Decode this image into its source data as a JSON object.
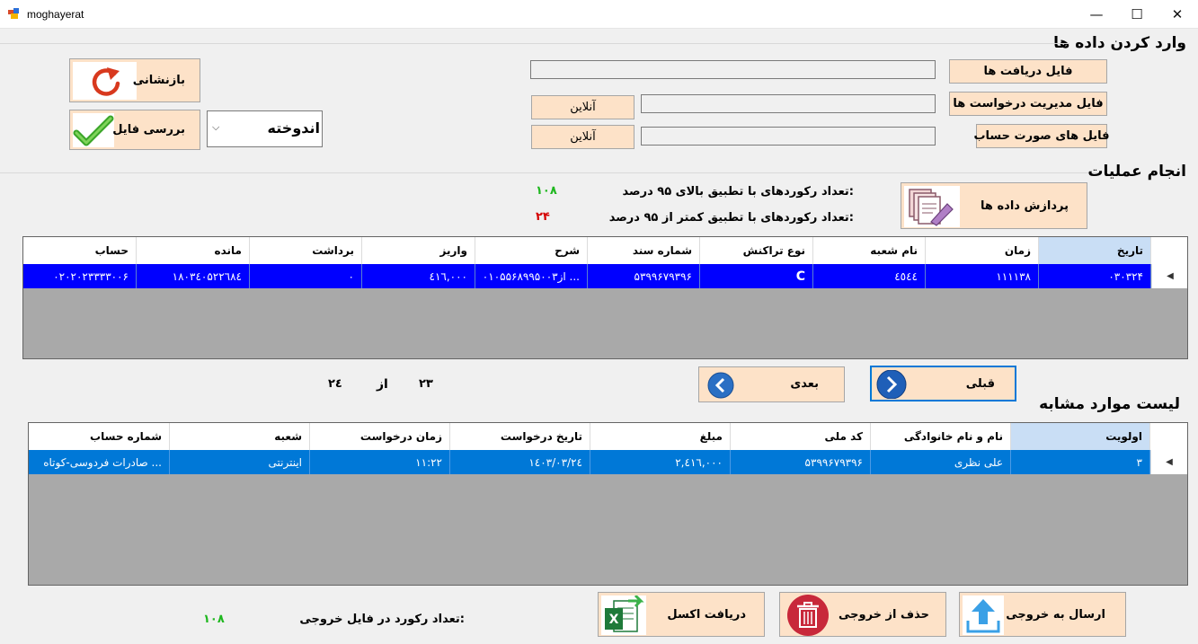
{
  "window": {
    "title": "moghayerat",
    "minimize": "—",
    "maximize": "☐",
    "close": "✕"
  },
  "data_entry": {
    "section_title": "وارد کردن داده ها",
    "receive_file_button": "فایل دریافت ها",
    "request_mgmt_button": "فایل مدیریت درخواست ها",
    "statements_button": "فایل های صورت حساب",
    "online_button_1": "آنلاین",
    "online_button_2": "آنلاین",
    "reset_button": "بازنشانی",
    "check_file_button": "بررسی فایل",
    "account_type_selected": "اندوخته"
  },
  "operations": {
    "section_title": "انجام عملیات",
    "process_button": "پردازش داده ها",
    "match_above_label": "تعداد رکوردهای با تطبیق بالای ۹۵ درصد:",
    "match_above_value": "۱۰۸",
    "match_below_label": "تعداد رکوردهای با تطبیق کمتر از ۹۵ درصد:",
    "match_below_value": "۲۴",
    "colors": {
      "above": "#1fb71f",
      "below": "#d40000"
    }
  },
  "transactions_grid": {
    "columns": [
      "تاریخ",
      "زمان",
      "نام شعبه",
      "نوع تراکنش",
      "شماره سند",
      "شرح",
      "واریز",
      "برداشت",
      "مانده",
      "حساب"
    ],
    "rows": [
      [
        "۰۳۰۳۲۴",
        "۱۱۱۱۳۸",
        "٤٥٤٤",
        "C",
        "۵۳۹۹۶۷۹۳۹۶",
        "از۰۱۰۵۵۶۸۹۹۵۰۰۳ ...",
        "٤١٦,۰۰۰",
        "۰",
        "۱۸۰۳٤۰۵۲۲٦۸٤",
        "۰۲۰۲۰۲۳۳۳۳۰۰۶"
      ]
    ]
  },
  "pagination": {
    "next_button": "بعدی",
    "prev_button": "قبلی",
    "current": "۲۳",
    "of": "از",
    "total": "۲٤"
  },
  "similar_list": {
    "section_title": "لیست موارد مشابه",
    "columns": [
      "اولویت",
      "نام و نام خانوادگی",
      "کد ملی",
      "مبلغ",
      "تاریخ درخواست",
      "زمان درخواست",
      "شعبه",
      "شماره حساب"
    ],
    "rows": [
      [
        "۳",
        "علی نظری",
        "۵۳۹۹۶۷۹۳۹۶",
        "۲,٤١٦,۰۰۰",
        "۱٤۰۳/۰۳/۲٤",
        "۱۱:۲۲",
        "اینترنتی",
        "صادرات فردوسی-کوتاه ..."
      ]
    ]
  },
  "footer": {
    "send_button": "ارسال به خروجی",
    "delete_button": "حذف از خروجی",
    "excel_button": "دریافت اکسل",
    "output_count_label": "تعداد رکورد در فایل خروجی:",
    "output_count_value": "۱۰۸"
  },
  "colors": {
    "button_bg": "#fde2c8",
    "selected_row": "#0000ff",
    "selected_row_2": "#0078d7",
    "header_selected": "#c9def5",
    "grid_bg": "#a9a9a9"
  }
}
